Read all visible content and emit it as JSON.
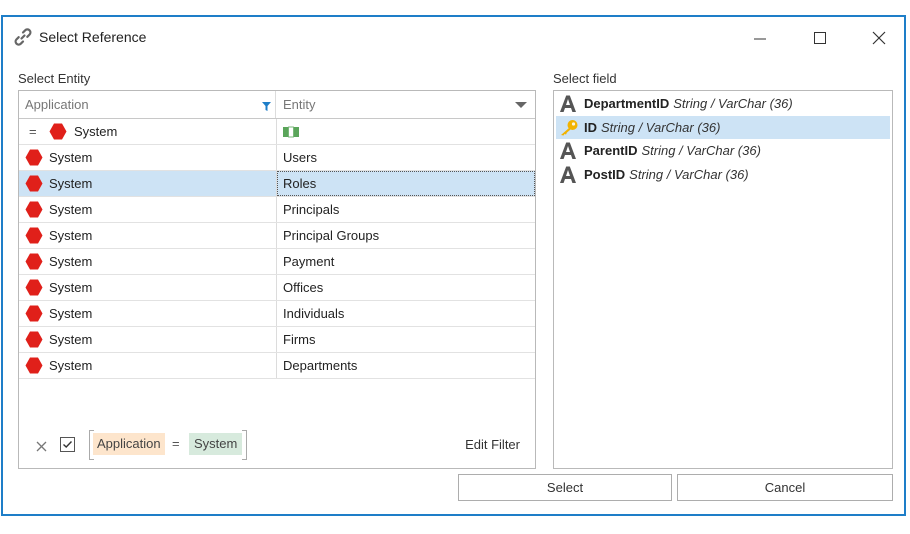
{
  "window": {
    "title": "Select Reference",
    "title_icon": "link-icon"
  },
  "entity_section": {
    "label": "Select Entity",
    "columns": {
      "application": "Application",
      "entity": "Entity"
    },
    "filter_row": {
      "operator": "=",
      "application": "System"
    },
    "rows": [
      {
        "application": "System",
        "entity": "Users"
      },
      {
        "application": "System",
        "entity": "Roles"
      },
      {
        "application": "System",
        "entity": "Principals"
      },
      {
        "application": "System",
        "entity": "Principal Groups"
      },
      {
        "application": "System",
        "entity": "Payment"
      },
      {
        "application": "System",
        "entity": "Offices"
      },
      {
        "application": "System",
        "entity": "Individuals"
      },
      {
        "application": "System",
        "entity": "Firms"
      },
      {
        "application": "System",
        "entity": "Departments"
      }
    ],
    "selected_index": 1,
    "filter": {
      "field": "Application",
      "operator": "=",
      "value": "System",
      "edit_label": "Edit Filter"
    }
  },
  "field_section": {
    "label": "Select field",
    "fields": [
      {
        "name": "DepartmentID",
        "type": "String / VarChar (36)",
        "icon": "text-field-icon"
      },
      {
        "name": "ID",
        "type": "String / VarChar (36)",
        "icon": "key-icon"
      },
      {
        "name": "ParentID",
        "type": "String / VarChar (36)",
        "icon": "text-field-icon"
      },
      {
        "name": "PostID",
        "type": "String / VarChar (36)",
        "icon": "text-field-icon"
      }
    ],
    "selected_index": 1
  },
  "buttons": {
    "select": "Select",
    "cancel": "Cancel"
  },
  "colors": {
    "accent": "#1e7ec8",
    "selection": "#cde3f5",
    "entity_hex": "#e0201a",
    "key": "#f2b300",
    "filter_field_bg": "#fde5cc",
    "filter_value_bg": "#d7eadd"
  }
}
